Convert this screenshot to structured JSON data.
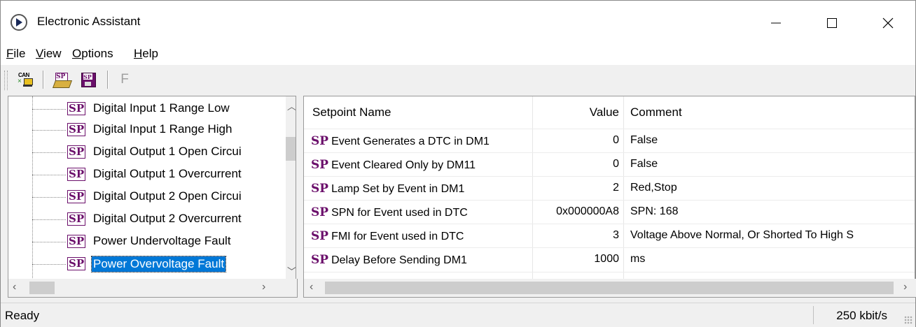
{
  "window": {
    "title": "Electronic Assistant"
  },
  "menu": {
    "items": [
      {
        "label": "File",
        "u": "F",
        "rest": "ile"
      },
      {
        "label": "View",
        "u": "V",
        "rest": "iew"
      },
      {
        "label": "Options",
        "u": "O",
        "rest": "ptions"
      },
      {
        "label": "Help",
        "u": "H",
        "rest": "elp"
      }
    ]
  },
  "toolbar": {
    "can_label": "CAN",
    "sp_label": "SP",
    "f_label": "F"
  },
  "tree": {
    "items": [
      {
        "icon": "SP",
        "label": "Digital Input 1 Range Low"
      },
      {
        "icon": "SP",
        "label": "Digital Input 1 Range High"
      },
      {
        "icon": "SP",
        "label": "Digital Output 1 Open Circui"
      },
      {
        "icon": "SP",
        "label": "Digital Output 1 Overcurrent"
      },
      {
        "icon": "SP",
        "label": "Digital Output 2 Open Circui"
      },
      {
        "icon": "SP",
        "label": "Digital Output 2 Overcurrent"
      },
      {
        "icon": "SP",
        "label": "Power Undervoltage Fault"
      },
      {
        "icon": "SP",
        "label": "Power Overvoltage Fault"
      }
    ],
    "selected_index": 7
  },
  "grid": {
    "columns": [
      "Setpoint Name",
      "Value",
      "Comment"
    ],
    "rows": [
      {
        "icon": "SP",
        "name": "Event Generates a DTC in DM1",
        "value": "0",
        "comment": "False"
      },
      {
        "icon": "SP",
        "name": "Event Cleared Only by DM11",
        "value": "0",
        "comment": "False"
      },
      {
        "icon": "SP",
        "name": "Lamp Set by Event in DM1",
        "value": "2",
        "comment": "Red,Stop"
      },
      {
        "icon": "SP",
        "name": "SPN for Event used in DTC",
        "value": "0x000000A8",
        "comment": "SPN: 168"
      },
      {
        "icon": "SP",
        "name": "FMI for Event used in DTC",
        "value": "3",
        "comment": "Voltage Above Normal, Or Shorted To High S"
      },
      {
        "icon": "SP",
        "name": "Delay Before Sending DM1",
        "value": "1000",
        "comment": "ms"
      }
    ]
  },
  "status": {
    "left": "Ready",
    "right": "250 kbit/s"
  }
}
